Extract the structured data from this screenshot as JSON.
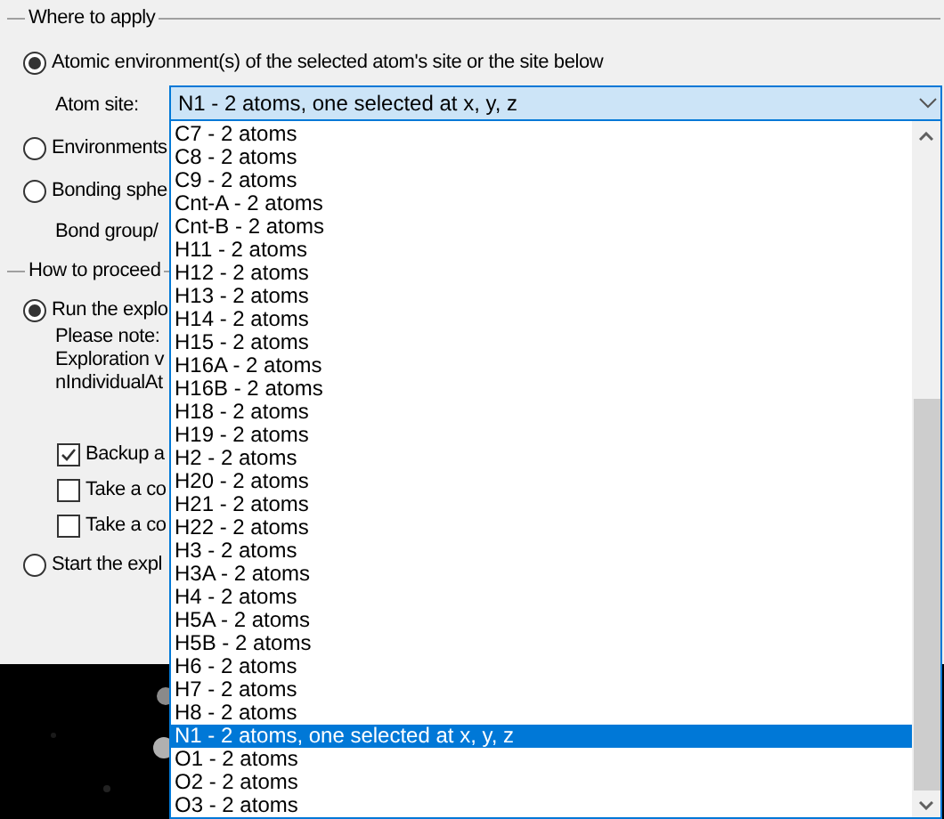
{
  "sections": [
    {
      "legend": "Where to apply",
      "items": [
        {
          "kind": "radio",
          "label": "Atomic environment(s) of the selected atom's site or the site below",
          "selected": true
        },
        {
          "kind": "combo",
          "label": "Atom site:",
          "value": "N1 - 2 atoms, one selected at x, y, z",
          "options": [
            {
              "label": "C7 - 2 atoms",
              "selected": false
            },
            {
              "label": "C8 - 2 atoms",
              "selected": false
            },
            {
              "label": "C9 - 2 atoms",
              "selected": false
            },
            {
              "label": "Cnt-A - 2 atoms",
              "selected": false
            },
            {
              "label": "Cnt-B - 2 atoms",
              "selected": false
            },
            {
              "label": "H11 - 2 atoms",
              "selected": false
            },
            {
              "label": "H12 - 2 atoms",
              "selected": false
            },
            {
              "label": "H13 - 2 atoms",
              "selected": false
            },
            {
              "label": "H14 - 2 atoms",
              "selected": false
            },
            {
              "label": "H15 - 2 atoms",
              "selected": false
            },
            {
              "label": "H16A - 2 atoms",
              "selected": false
            },
            {
              "label": "H16B - 2 atoms",
              "selected": false
            },
            {
              "label": "H18 - 2 atoms",
              "selected": false
            },
            {
              "label": "H19 - 2 atoms",
              "selected": false
            },
            {
              "label": "H2 - 2 atoms",
              "selected": false
            },
            {
              "label": "H20 - 2 atoms",
              "selected": false
            },
            {
              "label": "H21 - 2 atoms",
              "selected": false
            },
            {
              "label": "H22 - 2 atoms",
              "selected": false
            },
            {
              "label": "H3 - 2 atoms",
              "selected": false
            },
            {
              "label": "H3A - 2 atoms",
              "selected": false
            },
            {
              "label": "H4 - 2 atoms",
              "selected": false
            },
            {
              "label": "H5A - 2 atoms",
              "selected": false
            },
            {
              "label": "H5B - 2 atoms",
              "selected": false
            },
            {
              "label": "H6 - 2 atoms",
              "selected": false
            },
            {
              "label": "H7 - 2 atoms",
              "selected": false
            },
            {
              "label": "H8 - 2 atoms",
              "selected": false
            },
            {
              "label": "N1 - 2 atoms, one selected at x, y, z",
              "selected": true
            },
            {
              "label": "O1 - 2 atoms",
              "selected": false
            },
            {
              "label": "O2 - 2 atoms",
              "selected": false
            },
            {
              "label": "O3 - 2 atoms",
              "selected": false
            }
          ]
        },
        {
          "kind": "radio",
          "label": "Environments",
          "selected": false
        },
        {
          "kind": "radio",
          "label": "Bonding sphe",
          "selected": false
        },
        {
          "kind": "label",
          "label": "Bond group/"
        }
      ]
    },
    {
      "legend": "How to proceed",
      "items": [
        {
          "kind": "radio",
          "label": "Run the explo",
          "selected": true
        },
        {
          "kind": "note",
          "lines": [
            "Please note:",
            "Exploration v",
            "nIndividualAt"
          ]
        },
        {
          "kind": "checkbox",
          "label": "Backup a",
          "checked": true
        },
        {
          "kind": "checkbox",
          "label": "Take a co",
          "checked": false
        },
        {
          "kind": "checkbox",
          "label": "Take a co",
          "checked": false
        },
        {
          "kind": "radio",
          "label": "Start the expl",
          "selected": false
        }
      ]
    }
  ]
}
